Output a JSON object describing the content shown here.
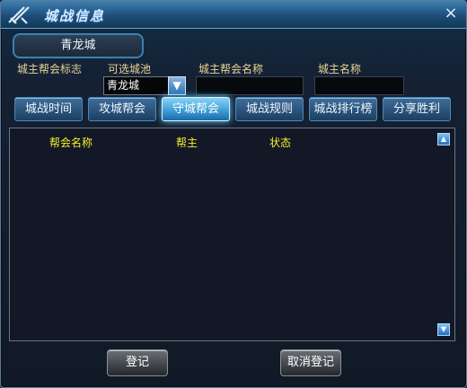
{
  "window": {
    "title": "城战信息",
    "close_label": "×"
  },
  "city_tab": {
    "label": "青龙城"
  },
  "labels": {
    "guild_logo": "城主帮会标志",
    "selectable_city": "可选城池",
    "owner_guild_name": "城主帮会名称",
    "owner_name": "城主名称"
  },
  "selector": {
    "selected_value": "青龙城",
    "button_icon": "dropdown-arrow"
  },
  "tabs": [
    {
      "label": "城战时间"
    },
    {
      "label": "攻城帮会"
    },
    {
      "label": "守城帮会"
    },
    {
      "label": "城战规则"
    },
    {
      "label": "城战排行榜"
    },
    {
      "label": "分享胜利"
    }
  ],
  "table": {
    "headers": [
      "帮会名称",
      "帮主",
      "状态"
    ],
    "rows": []
  },
  "buttons": {
    "register": "登记",
    "cancel_register": "取消登记"
  },
  "colors": {
    "label_gold": "#e9d493",
    "header_yellow": "#f5ef2a",
    "active_tab": "#3ea0d8"
  }
}
